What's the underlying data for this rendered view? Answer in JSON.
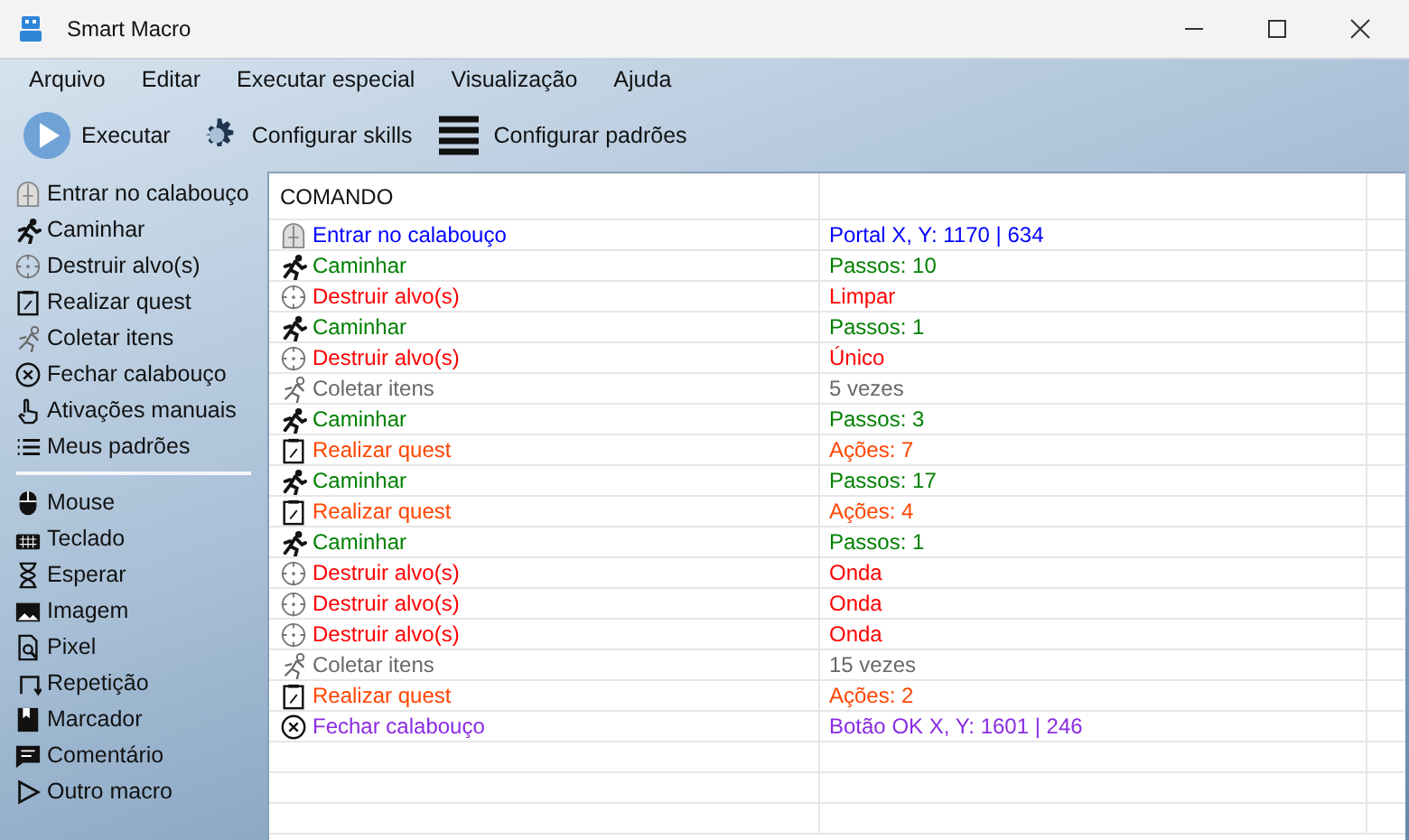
{
  "window": {
    "title": "Smart Macro"
  },
  "menu": [
    "Arquivo",
    "Editar",
    "Executar especial",
    "Visualização",
    "Ajuda"
  ],
  "toolbar": [
    {
      "kind": "play",
      "label": "Executar"
    },
    {
      "kind": "gear",
      "label": "Configurar skills"
    },
    {
      "kind": "list",
      "label": "Configurar padrões"
    }
  ],
  "sidebar": {
    "skills": [
      {
        "kind": "dungeon",
        "label": "Entrar no calabouço"
      },
      {
        "kind": "walk",
        "label": "Caminhar"
      },
      {
        "kind": "target",
        "label": "Destruir alvo(s)"
      },
      {
        "kind": "quest",
        "label": "Realizar quest"
      },
      {
        "kind": "collect",
        "label": "Coletar itens"
      },
      {
        "kind": "close",
        "label": "Fechar calabouço"
      },
      {
        "kind": "manual",
        "label": "Ativações manuais"
      },
      {
        "kind": "patterns",
        "label": "Meus padrões"
      }
    ],
    "actions": [
      {
        "kind": "mouse",
        "label": "Mouse"
      },
      {
        "kind": "keyboard",
        "label": "Teclado"
      },
      {
        "kind": "wait",
        "label": "Esperar"
      },
      {
        "kind": "image",
        "label": "Imagem"
      },
      {
        "kind": "pixel",
        "label": "Pixel"
      },
      {
        "kind": "repeat",
        "label": "Repetição"
      },
      {
        "kind": "bookmark",
        "label": "Marcador"
      },
      {
        "kind": "comment",
        "label": "Comentário"
      },
      {
        "kind": "macro",
        "label": "Outro macro"
      }
    ]
  },
  "table": {
    "columns": [
      "COMANDO"
    ],
    "rows": [
      {
        "kind": "dungeon",
        "color": "#0000ff",
        "command": "Entrar no calabouço",
        "value": "Portal X, Y: 1170 | 634"
      },
      {
        "kind": "walk",
        "color": "#008000",
        "command": "Caminhar",
        "value": "Passos: 10"
      },
      {
        "kind": "target",
        "color": "#ff0000",
        "command": "Destruir alvo(s)",
        "value": "Limpar"
      },
      {
        "kind": "walk",
        "color": "#008000",
        "command": "Caminhar",
        "value": "Passos: 1"
      },
      {
        "kind": "target",
        "color": "#ff0000",
        "command": "Destruir alvo(s)",
        "value": "Único"
      },
      {
        "kind": "collect",
        "color": "#696969",
        "command": "Coletar itens",
        "value": "5 vezes"
      },
      {
        "kind": "walk",
        "color": "#008000",
        "command": "Caminhar",
        "value": "Passos: 3"
      },
      {
        "kind": "quest",
        "color": "#ff4500",
        "command": "Realizar quest",
        "value": "Ações: 7"
      },
      {
        "kind": "walk",
        "color": "#008000",
        "command": "Caminhar",
        "value": "Passos: 17"
      },
      {
        "kind": "quest",
        "color": "#ff4500",
        "command": "Realizar quest",
        "value": "Ações: 4"
      },
      {
        "kind": "walk",
        "color": "#008000",
        "command": "Caminhar",
        "value": "Passos: 1"
      },
      {
        "kind": "target",
        "color": "#ff0000",
        "command": "Destruir alvo(s)",
        "value": "Onda"
      },
      {
        "kind": "target",
        "color": "#ff0000",
        "command": "Destruir alvo(s)",
        "value": "Onda"
      },
      {
        "kind": "target",
        "color": "#ff0000",
        "command": "Destruir alvo(s)",
        "value": "Onda"
      },
      {
        "kind": "collect",
        "color": "#696969",
        "command": "Coletar itens",
        "value": "15 vezes"
      },
      {
        "kind": "quest",
        "color": "#ff4500",
        "command": "Realizar quest",
        "value": "Ações: 2"
      },
      {
        "kind": "close",
        "color": "#8a2be2",
        "command": "Fechar calabouço",
        "value": "Botão OK X, Y: 1601 | 246"
      }
    ]
  }
}
